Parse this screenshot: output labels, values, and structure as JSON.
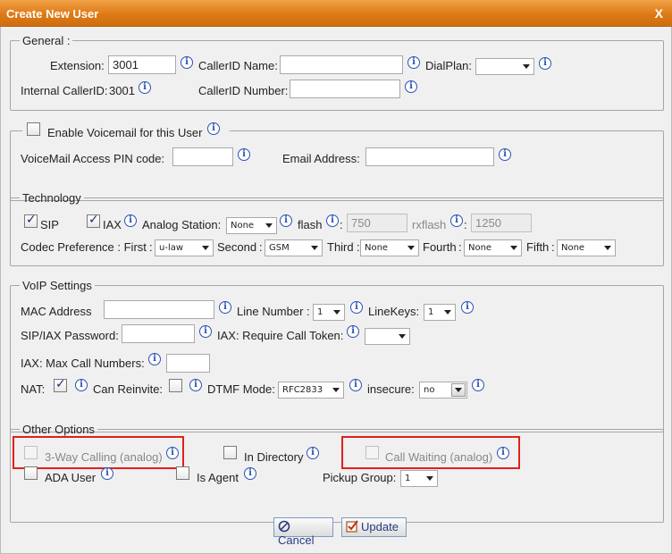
{
  "dialog": {
    "title": "Create New User",
    "close_label": "X"
  },
  "general": {
    "legend": "General :",
    "extension_label": "Extension:",
    "extension_value": "3001",
    "callerid_name_label": "CallerID Name:",
    "callerid_name_value": "",
    "dialplan_label": "DialPlan:",
    "dialplan_value": "",
    "internal_callerid_label": "Internal CallerID:",
    "internal_callerid_value": "3001",
    "callerid_number_label": "CallerID Number:",
    "callerid_number_value": ""
  },
  "voicemail": {
    "enable_label": "Enable Voicemail for this User",
    "enabled": false,
    "pin_label": "VoiceMail Access PIN code:",
    "pin_value": "",
    "email_label": "Email Address:",
    "email_value": ""
  },
  "technology": {
    "legend": "Technology",
    "sip_label": "SIP",
    "sip_checked": true,
    "iax_label": "IAX",
    "iax_checked": true,
    "analog_label": "Analog Station:",
    "analog_value": "None",
    "flash_label": "flash",
    "flash_value": "750",
    "rxflash_label": "rxflash",
    "rxflash_value": "1250",
    "codec_label": "Codec Preference : First",
    "codec_first": "u-law",
    "second_label": "Second",
    "codec_second": "GSM",
    "third_label": "Third",
    "codec_third": "None",
    "fourth_label": "Fourth",
    "codec_fourth": "None",
    "fifth_label": "Fifth",
    "codec_fifth": "None"
  },
  "voip": {
    "legend": "VoIP Settings",
    "mac_label": "MAC Address",
    "mac_value": "",
    "line_number_label": "Line Number :",
    "line_number_value": "1",
    "linekeys_label": "LineKeys:",
    "linekeys_value": "1",
    "password_label": "SIP/IAX Password:",
    "password_value": "",
    "iax_token_label": "IAX: Require Call Token:",
    "iax_token_value": "",
    "max_calls_label": "IAX: Max Call Numbers:",
    "max_calls_value": "",
    "nat_label": "NAT:",
    "nat_checked": true,
    "can_reinvite_label": "Can Reinvite:",
    "can_reinvite_checked": false,
    "dtmf_label": "DTMF Mode:",
    "dtmf_value": "RFC2833",
    "insecure_label": "insecure:",
    "insecure_value": "no"
  },
  "other": {
    "legend": "Other Options",
    "three_way_label": "3-Way Calling (analog)",
    "in_directory_label": "In Directory",
    "call_waiting_label": "Call Waiting (analog)",
    "ada_user_label": "ADA User",
    "is_agent_label": "Is Agent",
    "pickup_group_label": "Pickup Group:",
    "pickup_group_value": "1"
  },
  "buttons": {
    "cancel_label": "Cancel",
    "update_label": "Update"
  },
  "icons": {
    "info": "info-icon",
    "close": "close-icon",
    "cancel": "cancel-icon",
    "update": "update-icon"
  },
  "colors": {
    "title_bar": "#dd7a16",
    "highlight": "#e0201a",
    "info_icon": "#2a50b5"
  }
}
